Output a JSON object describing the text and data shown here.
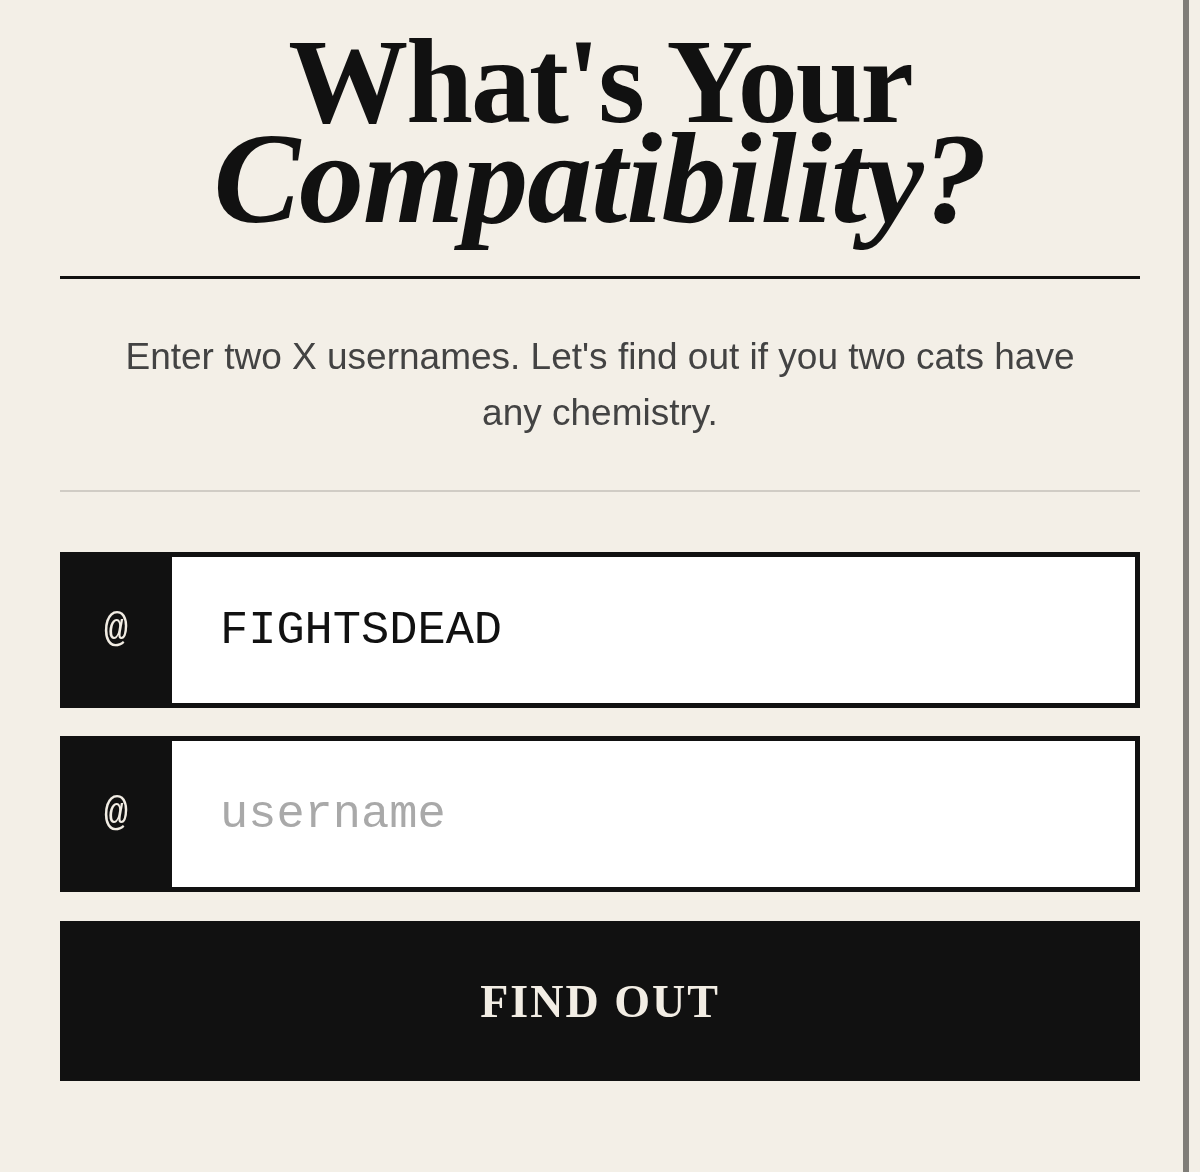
{
  "heading": "What's Your *Compatibility?*",
  "intro": "Enter two X usernames. Let's find out if you two cats have any chemistry.",
  "fields": [
    {
      "prefix": "@",
      "value": "FIGHTSDEAD"
    },
    {
      "prefix": "@",
      "placeholder": "username"
    }
  ],
  "button": {
    "label": "FIND OUT"
  }
}
